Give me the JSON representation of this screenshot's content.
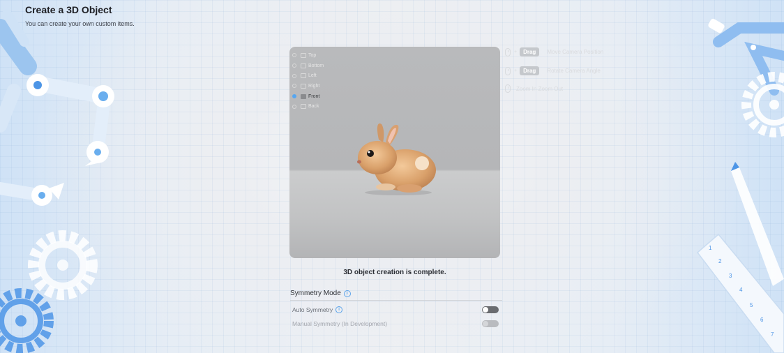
{
  "header": {
    "title": "Create a 3D Object",
    "subtitle": "You can create your own custom items."
  },
  "viewport": {
    "views": [
      {
        "label": "Top",
        "icon": "top-view-icon",
        "selected": false
      },
      {
        "label": "Bottom",
        "icon": "bottom-view-icon",
        "selected": false
      },
      {
        "label": "Left",
        "icon": "left-view-icon",
        "selected": false
      },
      {
        "label": "Right",
        "icon": "right-view-icon",
        "selected": false
      },
      {
        "label": "Front",
        "icon": "front-view-icon",
        "selected": true
      },
      {
        "label": "Back",
        "icon": "back-view-icon",
        "selected": false
      }
    ],
    "object": "rabbit-model"
  },
  "controls": {
    "drag_label": "Drag",
    "move_camera": "Move Camera Position",
    "rotate_camera": "Rotate Camera Angle",
    "zoom": "Zoom In Zoom Out"
  },
  "status": {
    "message": "3D object creation is complete."
  },
  "symmetry": {
    "title": "Symmetry Mode",
    "auto_label": "Auto Symmetry",
    "auto_enabled": false,
    "manual_label": "Manual Symmetry (In Development)",
    "manual_enabled": false,
    "manual_disabled": true
  },
  "colors": {
    "accent": "#56a6f0",
    "title_text": "#1e1f24"
  }
}
